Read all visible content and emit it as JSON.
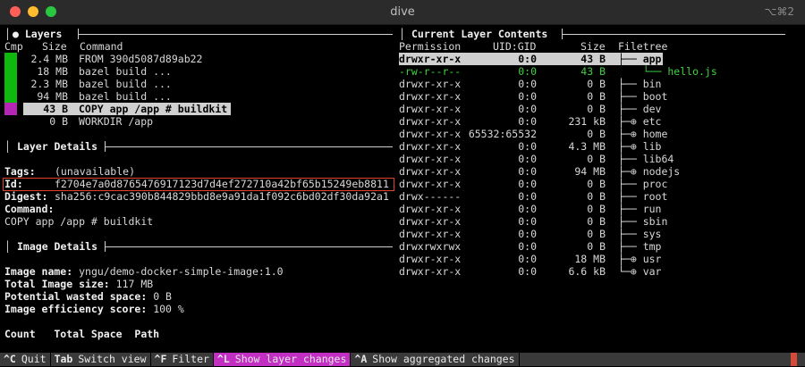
{
  "window": {
    "title": "dive",
    "shortcut": "⌥⌘2"
  },
  "layers": {
    "title": "Layers",
    "headers": {
      "cmp": "Cmp",
      "size": "Size",
      "command": "Command"
    },
    "rows": [
      {
        "size": "2.4 MB",
        "command": "FROM 390d5087d89ab22",
        "bar": "#0fb80f",
        "selected": false
      },
      {
        "size": "18 MB",
        "command": "bazel build ...",
        "bar": "#0fb80f",
        "selected": false
      },
      {
        "size": "2.3 MB",
        "command": "bazel build ...",
        "bar": "#0fb80f",
        "selected": false
      },
      {
        "size": "94 MB",
        "command": "bazel build ...",
        "bar": "#0fb80f",
        "selected": false
      },
      {
        "size": "43 B",
        "command": "COPY app /app # buildkit",
        "bar": "#b526b5",
        "selected": true
      },
      {
        "size": "0 B",
        "command": "WORKDIR /app",
        "bar": "",
        "selected": false
      }
    ]
  },
  "layer_details": {
    "title": "Layer Details",
    "tags_label": "Tags:",
    "tags_value": "(unavailable)",
    "id_label": "Id:",
    "id_value": "f2704e7a0d8765476917123d7d4ef272710a42bf65b15249eb8811",
    "digest_label": "Digest:",
    "digest_value": "sha256:c9cac390b844829bbd8e9a91da1f092c6bd02df30da92a1",
    "command_label": "Command:",
    "command_value": "COPY app /app # buildkit"
  },
  "image_details": {
    "title": "Image Details",
    "name_label": "Image name:",
    "name_value": "yngu/demo-docker-simple-image:1.0",
    "size_label": "Total Image size:",
    "size_value": "117 MB",
    "wasted_label": "Potential wasted space:",
    "wasted_value": "0 B",
    "eff_label": "Image efficiency score:",
    "eff_value": "100 %",
    "table_header": "Count   Total Space  Path"
  },
  "contents": {
    "title": "Current Layer Contents",
    "headers": {
      "perm": "Permission",
      "uid": "UID:GID",
      "size": "Size",
      "tree": "Filetree"
    },
    "rows": [
      {
        "perm": "drwxr-xr-x",
        "uid": "0:0",
        "size": "43 B",
        "tree": "├── app",
        "style": "selected"
      },
      {
        "perm": "-rw-r--r--",
        "uid": "0:0",
        "size": "43 B",
        "tree": "    └── hello.js",
        "style": "green"
      },
      {
        "perm": "drwxr-xr-x",
        "uid": "0:0",
        "size": "0 B",
        "tree": "├── bin",
        "style": ""
      },
      {
        "perm": "drwxr-xr-x",
        "uid": "0:0",
        "size": "0 B",
        "tree": "├── boot",
        "style": ""
      },
      {
        "perm": "drwxr-xr-x",
        "uid": "0:0",
        "size": "0 B",
        "tree": "├── dev",
        "style": ""
      },
      {
        "perm": "drwxr-xr-x",
        "uid": "0:0",
        "size": "231 kB",
        "tree": "├─⊕ etc",
        "style": ""
      },
      {
        "perm": "drwxr-xr-x",
        "uid": "65532:65532",
        "size": "0 B",
        "tree": "├─⊕ home",
        "style": ""
      },
      {
        "perm": "drwxr-xr-x",
        "uid": "0:0",
        "size": "4.3 MB",
        "tree": "├─⊕ lib",
        "style": ""
      },
      {
        "perm": "drwxr-xr-x",
        "uid": "0:0",
        "size": "0 B",
        "tree": "├── lib64",
        "style": ""
      },
      {
        "perm": "drwxr-xr-x",
        "uid": "0:0",
        "size": "94 MB",
        "tree": "├─⊕ nodejs",
        "style": ""
      },
      {
        "perm": "drwxr-xr-x",
        "uid": "0:0",
        "size": "0 B",
        "tree": "├── proc",
        "style": ""
      },
      {
        "perm": "drwx------",
        "uid": "0:0",
        "size": "0 B",
        "tree": "├── root",
        "style": ""
      },
      {
        "perm": "drwxr-xr-x",
        "uid": "0:0",
        "size": "0 B",
        "tree": "├── run",
        "style": ""
      },
      {
        "perm": "drwxr-xr-x",
        "uid": "0:0",
        "size": "0 B",
        "tree": "├── sbin",
        "style": ""
      },
      {
        "perm": "drwxr-xr-x",
        "uid": "0:0",
        "size": "0 B",
        "tree": "├── sys",
        "style": ""
      },
      {
        "perm": "drwxrwxrwx",
        "uid": "0:0",
        "size": "0 B",
        "tree": "├── tmp",
        "style": ""
      },
      {
        "perm": "drwxr-xr-x",
        "uid": "0:0",
        "size": "18 MB",
        "tree": "├─⊕ usr",
        "style": ""
      },
      {
        "perm": "drwxr-xr-x",
        "uid": "0:0",
        "size": "6.6 kB",
        "tree": "└─⊕ var",
        "style": ""
      }
    ]
  },
  "footer": [
    {
      "key": "^C",
      "label": "Quit",
      "active": false
    },
    {
      "key": "Tab",
      "label": "Switch view",
      "active": false
    },
    {
      "key": "^F",
      "label": "Filter",
      "active": false
    },
    {
      "key": "^L",
      "label": "Show layer changes",
      "active": true
    },
    {
      "key": "^A",
      "label": "Show aggregated changes",
      "active": false
    }
  ]
}
